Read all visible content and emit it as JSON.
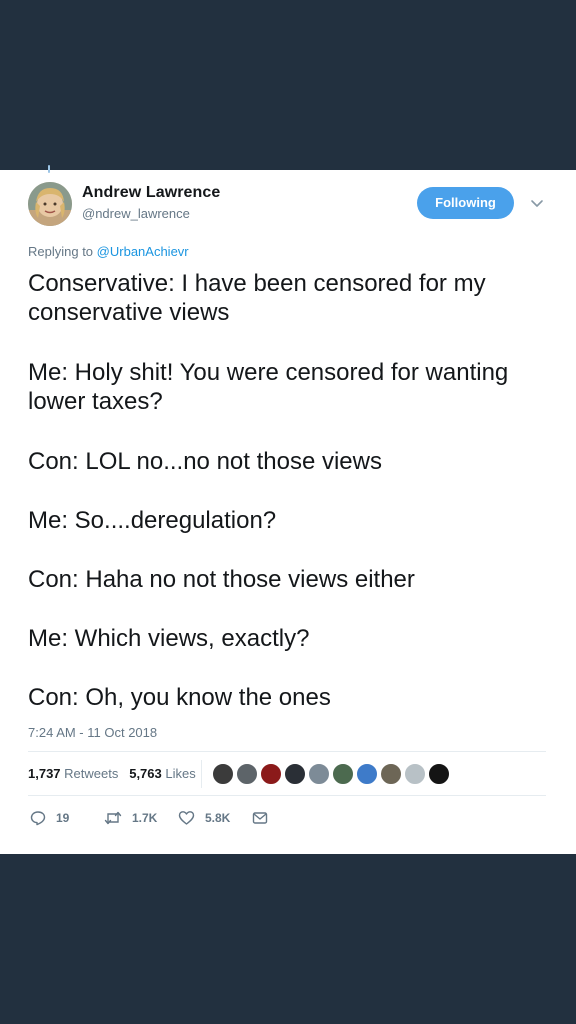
{
  "author": {
    "display_name": "Andrew Lawrence",
    "handle": "@ndrew_lawrence"
  },
  "follow_button": {
    "label": "Following"
  },
  "replying": {
    "prefix": "Replying to",
    "mention": "@UrbanAchievr"
  },
  "tweet": {
    "lines": [
      "Conservative: I have been censored for my conservative views",
      "Me: Holy shit! You were censored for wanting lower taxes?",
      "Con: LOL no...no not those views",
      "Me: So....deregulation?",
      "Con: Haha no not those views either",
      "Me: Which views, exactly?",
      "Con: Oh, you know the ones"
    ],
    "timestamp": "7:24 AM - 11 Oct 2018"
  },
  "stats": {
    "retweets_count": "1,737",
    "retweets_label": "Retweets",
    "likes_count": "5,763",
    "likes_label": "Likes"
  },
  "actions": {
    "replies": "19",
    "retweets": "1.7K",
    "likes": "5.8K"
  },
  "colors": {
    "background": "#22303f",
    "card": "#ffffff",
    "accent": "#1b95e0",
    "follow_button": "#4aa1eb",
    "muted_text": "#657786"
  },
  "icons": {
    "reply": "reply-icon",
    "retweet": "retweet-icon",
    "like": "heart-icon",
    "message": "envelope-icon",
    "caret": "chevron-down-icon"
  }
}
